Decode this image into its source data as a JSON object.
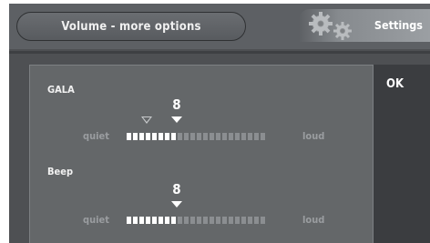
{
  "header": {
    "title": "Volume - more options",
    "settings_label": "Settings",
    "settings_icon": "gears-icon"
  },
  "ok_label": "OK",
  "sliders": [
    {
      "label": "GALA",
      "value": "8",
      "level": 8,
      "segments": 22,
      "previous_level": 4,
      "min_label": "quiet",
      "max_label": "loud"
    },
    {
      "label": "Beep",
      "value": "8",
      "level": 8,
      "segments": 22,
      "min_label": "quiet",
      "max_label": "loud"
    }
  ],
  "colors": {
    "background": "#4e5053",
    "panel": "#646769",
    "segment_on": "#ffffff",
    "segment_off": "#8b8e91",
    "text": "#ffffff",
    "muted_text": "#9a9da0"
  }
}
